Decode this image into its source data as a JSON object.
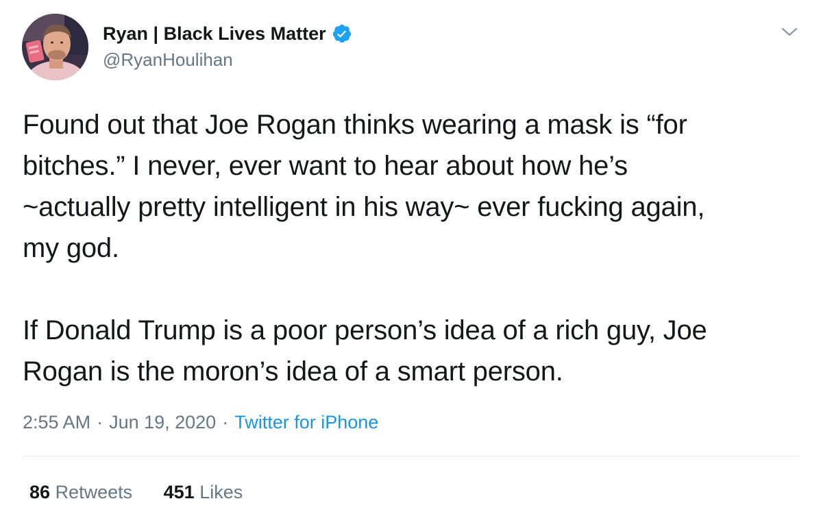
{
  "author": {
    "display_name": "Ryan | Black Lives Matter",
    "handle": "@RyanHoulihan",
    "verified": true,
    "verified_color": "#1da1f2"
  },
  "tweet": {
    "lines": [
      "Found out that Joe Rogan thinks wearing a mask is “for",
      "bitches.” I never, ever want to hear about how he’s",
      "~actually pretty intelligent in his way~ ever fucking again,",
      "my god.",
      "",
      "If Donald Trump is a poor person’s idea of a rich guy, Joe",
      "Rogan is the moron’s idea of a smart person."
    ]
  },
  "meta": {
    "time": "2:55 AM",
    "separator": "·",
    "date": "Jun 19, 2020",
    "source": "Twitter for iPhone",
    "source_color": "#1b95e0"
  },
  "stats": {
    "retweets_count": "86",
    "retweets_label": "Retweets",
    "likes_count": "451",
    "likes_label": "Likes"
  },
  "icons": {
    "menu": "chevron-down-icon",
    "verified": "verified-badge-icon"
  }
}
